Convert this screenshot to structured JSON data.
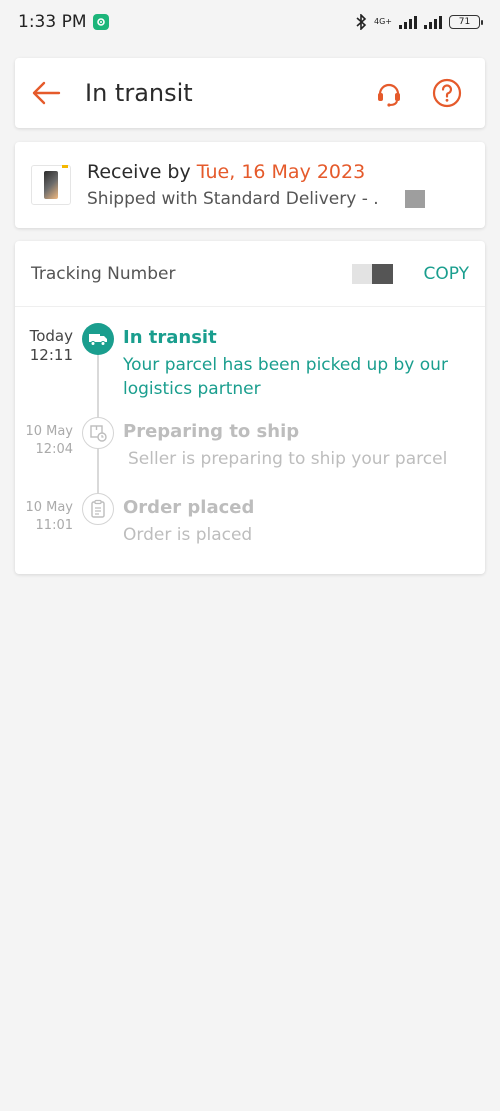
{
  "status_bar": {
    "time": "1:33 PM",
    "network": "4G+",
    "battery": "71"
  },
  "header": {
    "title": "In transit"
  },
  "delivery": {
    "receive_prefix": "Receive by ",
    "receive_date": "Tue, 16 May 2023",
    "shipping_method": "Shipped with Standard Delivery - ."
  },
  "tracking": {
    "label": "Tracking Number",
    "copy_label": "COPY"
  },
  "timeline": [
    {
      "date": "Today",
      "time": "12:11",
      "title": "In transit",
      "description": "Your parcel has been picked up by our logistics partner",
      "icon": "truck-icon",
      "active": true
    },
    {
      "date": "10 May",
      "time": "12:04",
      "title": "Preparing to ship",
      "description": "Seller is preparing to ship your parcel",
      "icon": "package-clock-icon",
      "active": false
    },
    {
      "date": "10 May",
      "time": "11:01",
      "title": "Order placed",
      "description": "Order is placed",
      "icon": "clipboard-icon",
      "active": false
    }
  ],
  "colors": {
    "accent_orange": "#e55a2b",
    "accent_teal": "#1a9e8e",
    "inactive_gray": "#bdbdbd"
  }
}
